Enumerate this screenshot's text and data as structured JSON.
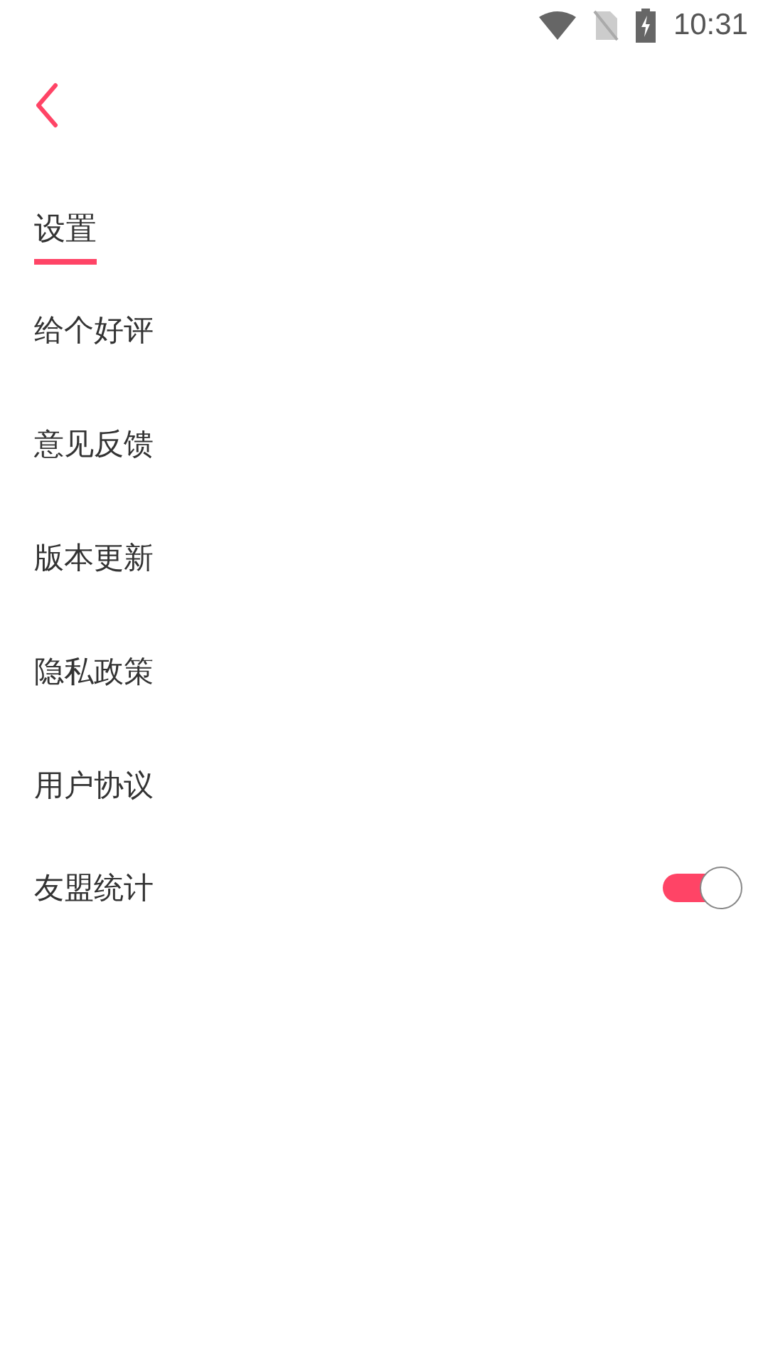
{
  "status_bar": {
    "time": "10:31"
  },
  "title": "设置",
  "items": [
    {
      "kind": "link",
      "label": "给个好评"
    },
    {
      "kind": "link",
      "label": "意见反馈"
    },
    {
      "kind": "link",
      "label": "版本更新"
    },
    {
      "kind": "link",
      "label": "隐私政策"
    },
    {
      "kind": "link",
      "label": "用户协议"
    },
    {
      "kind": "toggle",
      "label": "友盟统计",
      "on": true
    }
  ]
}
